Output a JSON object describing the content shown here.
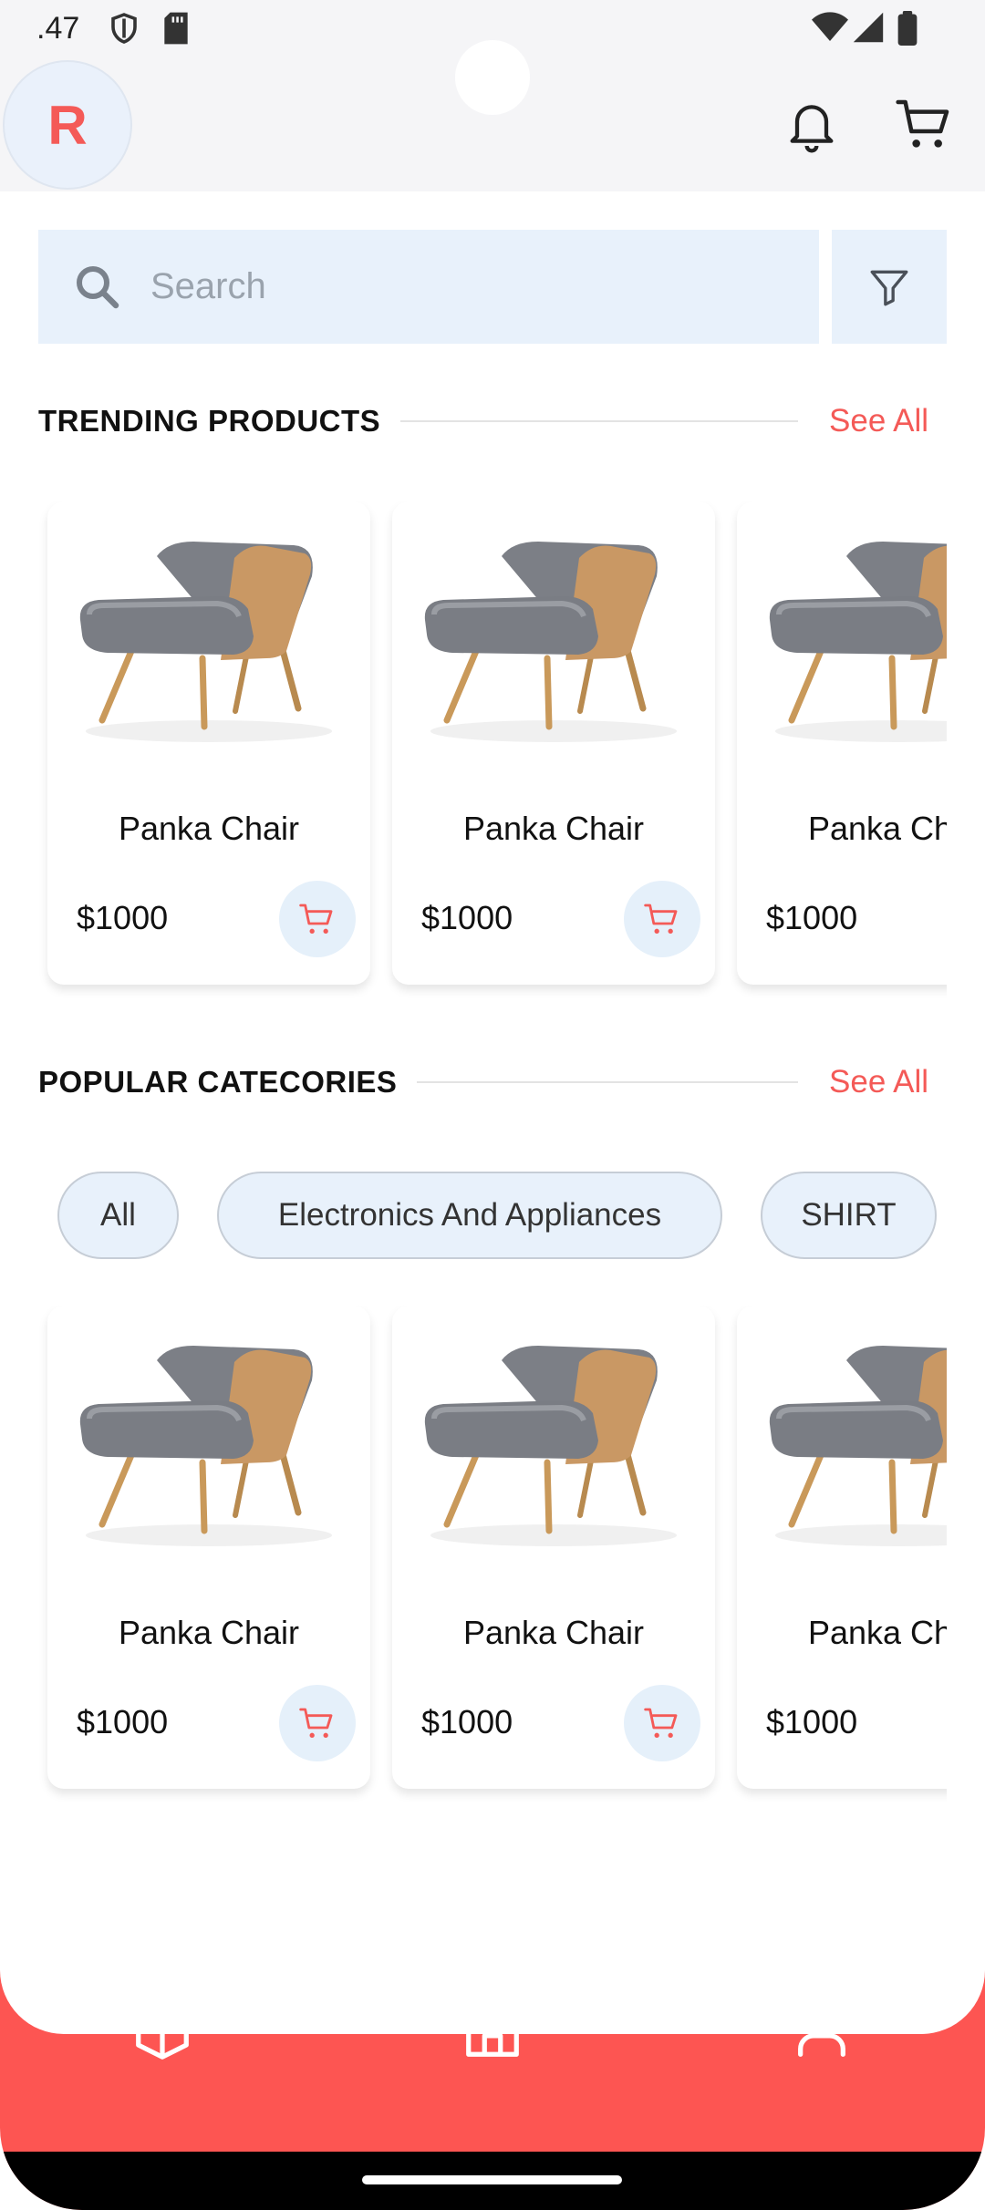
{
  "status_bar": {
    "time": ".47"
  },
  "header": {
    "avatar_letter": "R"
  },
  "search": {
    "placeholder": "Search"
  },
  "trending": {
    "title": "TRENDING PRODUCTS",
    "see_all": "See All",
    "products": [
      {
        "name": "Panka Chair",
        "price": "$1000"
      },
      {
        "name": "Panka Chair",
        "price": "$1000"
      },
      {
        "name": "Panka Chair",
        "price": "$1000"
      }
    ]
  },
  "popular": {
    "title": "POPULAR CATECORIES",
    "see_all": "See All",
    "chips": [
      "All",
      "Electronics And Appliances",
      "SHIRT"
    ],
    "products": [
      {
        "name": "Panka Chair",
        "price": "$1000"
      },
      {
        "name": "Panka Chair",
        "price": "$1000"
      },
      {
        "name": "Panka Chair",
        "price": "$1000"
      }
    ]
  },
  "bottom_nav": {
    "items": [
      "box-icon",
      "home-icon",
      "user-icon"
    ]
  },
  "colors": {
    "accent": "#f45a57",
    "nav_background": "#fd5552",
    "chip_background": "#e8f1fb"
  }
}
